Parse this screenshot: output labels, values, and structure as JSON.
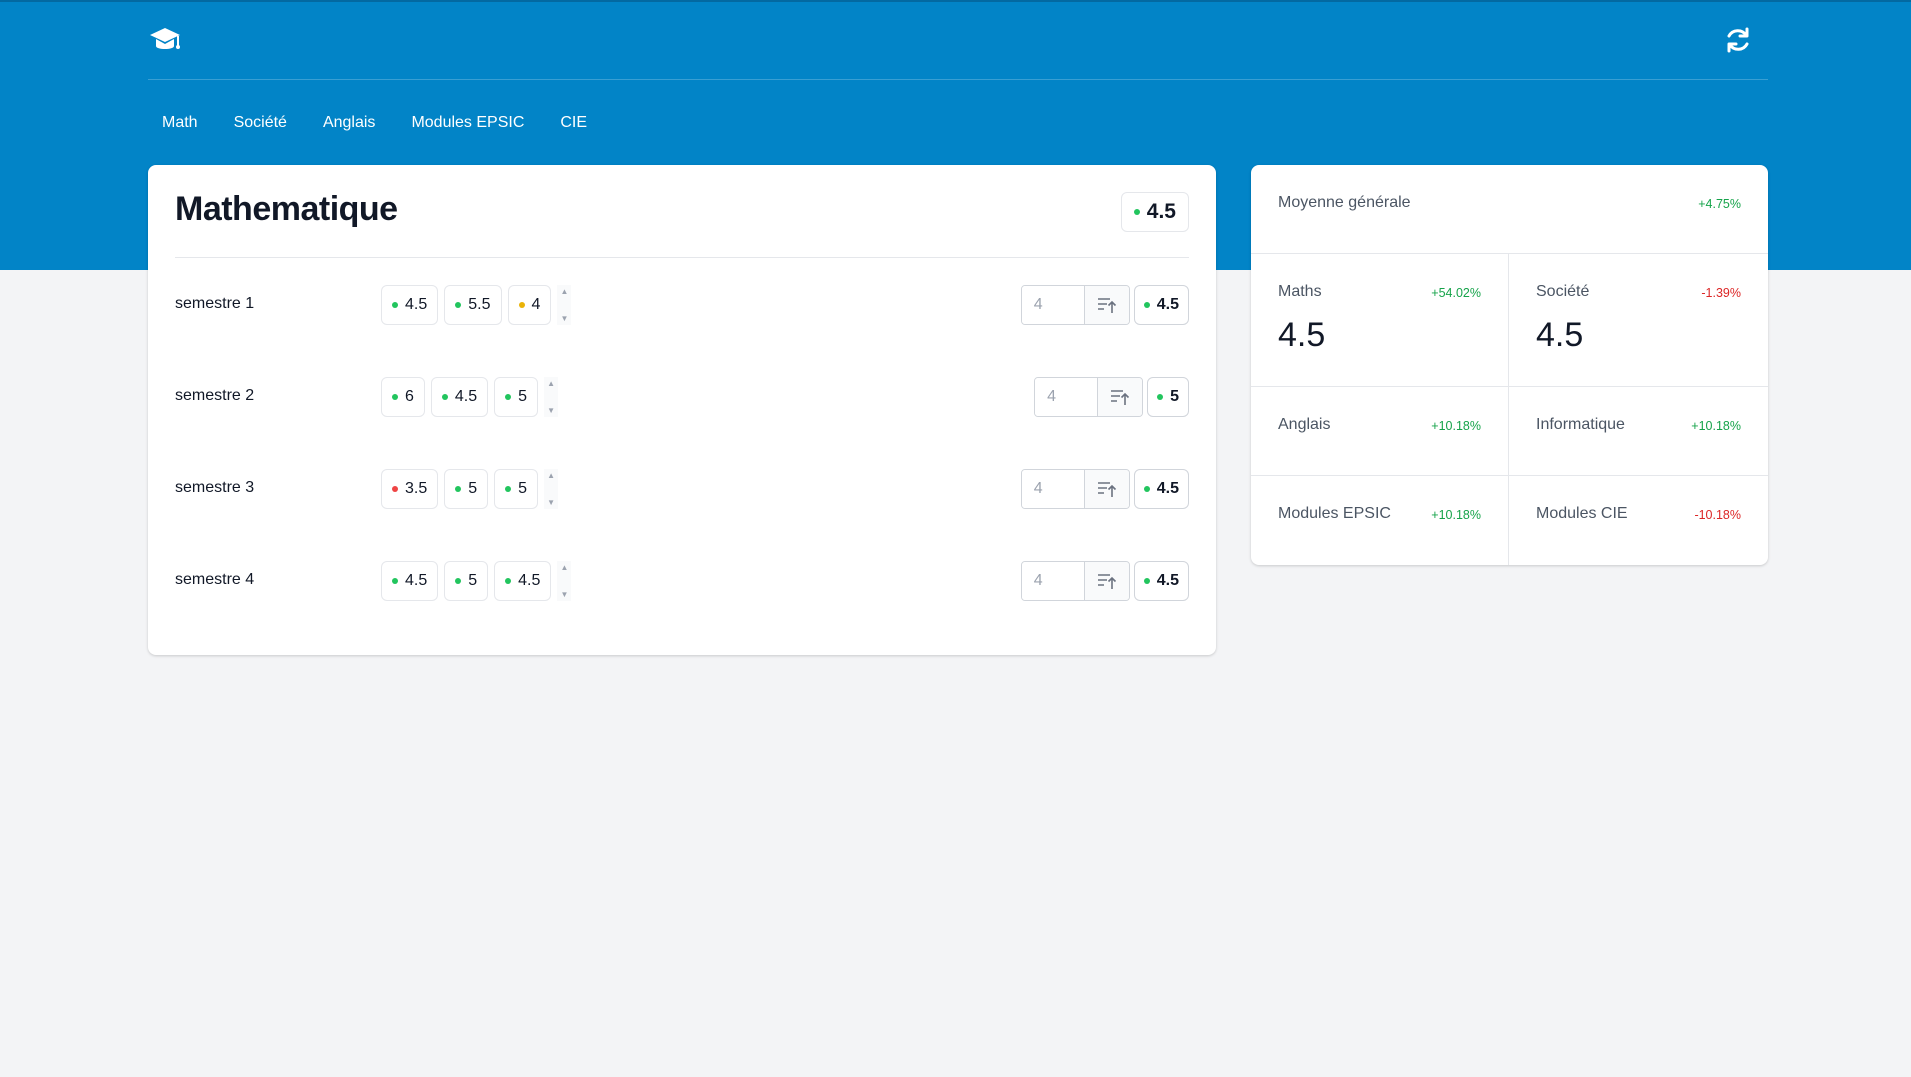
{
  "header": {
    "logo_icon": "graduation-cap-icon",
    "refresh_icon": "refresh-icon"
  },
  "nav": {
    "items": [
      {
        "label": "Math"
      },
      {
        "label": "Société"
      },
      {
        "label": "Anglais"
      },
      {
        "label": "Modules EPSIC"
      },
      {
        "label": "CIE"
      }
    ]
  },
  "subject": {
    "title": "Mathematique",
    "average": "4.5",
    "average_status": "green",
    "add_placeholder": "4",
    "semesters": [
      {
        "label": "semestre 1",
        "grades": [
          {
            "value": "4.5",
            "status": "green"
          },
          {
            "value": "5.5",
            "status": "green"
          },
          {
            "value": "4",
            "status": "yellow"
          }
        ],
        "average": "4.5",
        "average_status": "green"
      },
      {
        "label": "semestre 2",
        "grades": [
          {
            "value": "6",
            "status": "green"
          },
          {
            "value": "4.5",
            "status": "green"
          },
          {
            "value": "5",
            "status": "green"
          }
        ],
        "average": "5",
        "average_status": "green"
      },
      {
        "label": "semestre 3",
        "grades": [
          {
            "value": "3.5",
            "status": "red"
          },
          {
            "value": "5",
            "status": "green"
          },
          {
            "value": "5",
            "status": "green"
          }
        ],
        "average": "4.5",
        "average_status": "green"
      },
      {
        "label": "semestre 4",
        "grades": [
          {
            "value": "4.5",
            "status": "green"
          },
          {
            "value": "5",
            "status": "green"
          },
          {
            "value": "4.5",
            "status": "green"
          }
        ],
        "average": "4.5",
        "average_status": "green"
      }
    ]
  },
  "stats": {
    "general": {
      "label": "Moyenne générale",
      "delta": "+4.75%"
    },
    "maths": {
      "label": "Maths",
      "delta": "+54.02%",
      "value": "4.5"
    },
    "societe": {
      "label": "Société",
      "delta": "-1.39%",
      "value": "4.5"
    },
    "anglais": {
      "label": "Anglais",
      "delta": "+10.18%"
    },
    "informatique": {
      "label": "Informatique",
      "delta": "+10.18%"
    },
    "epsic": {
      "label": "Modules EPSIC",
      "delta": "+10.18%"
    },
    "cie": {
      "label": "Modules CIE",
      "delta": "-10.18%"
    }
  },
  "colors": {
    "brand": "#0284c7",
    "good": "#22c55e",
    "warning": "#eab308",
    "bad": "#ef4444",
    "positive_delta": "#16a34a",
    "negative_delta": "#dc2626"
  }
}
